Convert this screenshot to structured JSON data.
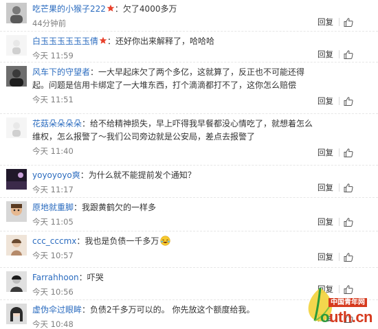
{
  "comments": [
    {
      "user": "吃芒果的小猴子222",
      "verified": true,
      "text": "欠了4000多万",
      "time": "44分钟前",
      "reply": "回复",
      "avatar": "gray-figure"
    },
    {
      "user": "白玉玉玉玉玉玉倩",
      "verified": true,
      "text": "还好你出来解释了，哈哈哈",
      "time": "今天 11:59",
      "reply": "回复",
      "avatar": "white-figure"
    },
    {
      "user": "风车下的守望者",
      "verified": false,
      "text": "一大早起床欠了两个多亿，这就算了，反正也不可能还得起。问题是信用卡绑定了一大堆东西，打个滴滴都打不了，这你怎么赔偿",
      "time": "今天 11:51",
      "reply": "回复",
      "avatar": "dark-figure"
    },
    {
      "user": "花菇朵朵朵朵",
      "verified": false,
      "text": "给不给精神损失，早上吓得我早餐都没心情吃了，就想着怎么维权，怎么报警了～我们公司旁边就是公安局，差点去报警了",
      "time": "今天 11:40",
      "reply": "回复",
      "avatar": "white-figure"
    },
    {
      "user": "yoyoyoyo爽",
      "verified": false,
      "text": "为什么就不能提前发个通知？",
      "time": "今天 11:17",
      "reply": "回复",
      "avatar": "dark-landscape"
    },
    {
      "user": "原地就重脚",
      "verified": false,
      "text": "我跟黄鹤欠的一样多",
      "time": "今天 11:05",
      "reply": "回复",
      "avatar": "cartoon"
    },
    {
      "user": "ccc_cccmx",
      "verified": false,
      "text": "我也是负债一千多万",
      "emoji": "laugh-cry-emoji",
      "time": "今天 10:57",
      "reply": "回复",
      "avatar": "portrait"
    },
    {
      "user": "Farrahhoon",
      "verified": false,
      "text": "吓哭",
      "time": "今天 10:56",
      "reply": "回复",
      "avatar": "bw-portrait"
    },
    {
      "user": "虚伪伞过眼眸",
      "verified": false,
      "text": "负债2千多万可以的。 你先放这个额度给我。",
      "time": "今天 10:48",
      "reply": "回复",
      "avatar": "girl"
    }
  ],
  "watermark": {
    "tag": "中国青年网",
    "site_o": "o",
    "site_rest": "uth.cn"
  },
  "colors": {
    "username": "#2a6bbf",
    "time": "#808080",
    "badge": "#e8412c",
    "watermark_red": "#d63a1e",
    "watermark_green": "#2a9a3a"
  }
}
